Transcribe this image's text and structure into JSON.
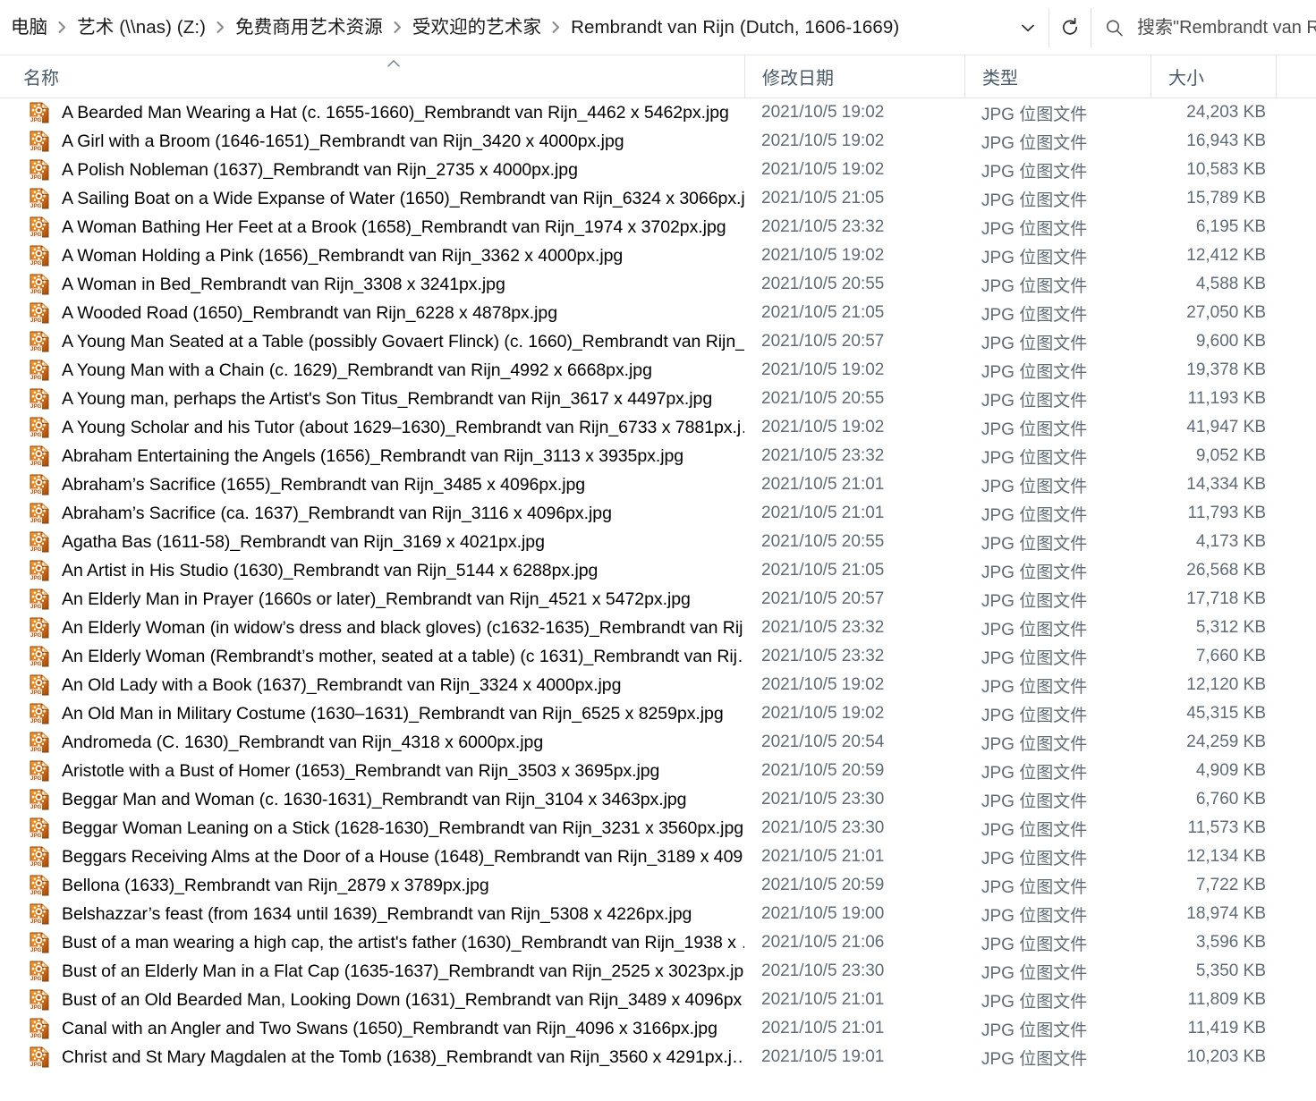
{
  "window": {
    "type": "file-explorer",
    "colors": {
      "header_text": "#4a5a6a",
      "secondary_text": "#5f6b76",
      "icon_orange": "#e08018",
      "icon_brown": "#a24a12",
      "divider": "#e3e3e3"
    }
  },
  "addressbar": {
    "breadcrumbs": [
      "电脑",
      "艺术 (\\\\nas) (Z:)",
      "免费商用艺术资源",
      "受欢迎的艺术家",
      "Rembrandt van Rijn (Dutch, 1606-1669)"
    ],
    "dropdown_icon": "chevron-down-icon",
    "refresh_icon": "refresh-icon",
    "search": {
      "icon": "search-icon",
      "placeholder": "搜索\"Rembrandt van Rij"
    }
  },
  "columns": {
    "name": "名称",
    "date_modified": "修改日期",
    "type": "类型",
    "size": "大小",
    "sort_indicator": "^"
  },
  "files": [
    {
      "name": "A Bearded Man Wearing a Hat (c. 1655-1660)_Rembrandt van Rijn_4462 x 5462px.jpg",
      "date": "2021/10/5 19:02",
      "type": "JPG 位图文件",
      "size": "24,203 KB"
    },
    {
      "name": "A Girl with a Broom (1646-1651)_Rembrandt van Rijn_3420 x 4000px.jpg",
      "date": "2021/10/5 19:02",
      "type": "JPG 位图文件",
      "size": "16,943 KB"
    },
    {
      "name": "A Polish Nobleman (1637)_Rembrandt van Rijn_2735 x 4000px.jpg",
      "date": "2021/10/5 19:02",
      "type": "JPG 位图文件",
      "size": "10,583 KB"
    },
    {
      "name": "A Sailing Boat on a Wide Expanse of Water (1650)_Rembrandt van Rijn_6324 x 3066px.j…",
      "date": "2021/10/5 21:05",
      "type": "JPG 位图文件",
      "size": "15,789 KB"
    },
    {
      "name": "A Woman Bathing Her Feet at a Brook (1658)_Rembrandt van Rijn_1974 x 3702px.jpg",
      "date": "2021/10/5 23:32",
      "type": "JPG 位图文件",
      "size": "6,195 KB"
    },
    {
      "name": "A Woman Holding a Pink (1656)_Rembrandt van Rijn_3362 x 4000px.jpg",
      "date": "2021/10/5 19:02",
      "type": "JPG 位图文件",
      "size": "12,412 KB"
    },
    {
      "name": "A Woman in Bed_Rembrandt van Rijn_3308 x 3241px.jpg",
      "date": "2021/10/5 20:55",
      "type": "JPG 位图文件",
      "size": "4,588 KB"
    },
    {
      "name": "A Wooded Road (1650)_Rembrandt van Rijn_6228 x 4878px.jpg",
      "date": "2021/10/5 21:05",
      "type": "JPG 位图文件",
      "size": "27,050 KB"
    },
    {
      "name": "A Young Man Seated at a Table (possibly Govaert Flinck) (c. 1660)_Rembrandt van Rijn_…",
      "date": "2021/10/5 20:57",
      "type": "JPG 位图文件",
      "size": "9,600 KB"
    },
    {
      "name": "A Young Man with a Chain (c. 1629)_Rembrandt van Rijn_4992 x 6668px.jpg",
      "date": "2021/10/5 19:02",
      "type": "JPG 位图文件",
      "size": "19,378 KB"
    },
    {
      "name": "A Young man, perhaps the Artist's Son Titus_Rembrandt van Rijn_3617 x 4497px.jpg",
      "date": "2021/10/5 20:55",
      "type": "JPG 位图文件",
      "size": "11,193 KB"
    },
    {
      "name": "A Young Scholar and his Tutor (about 1629–1630)_Rembrandt van Rijn_6733 x 7881px.j…",
      "date": "2021/10/5 19:02",
      "type": "JPG 位图文件",
      "size": "41,947 KB"
    },
    {
      "name": "Abraham Entertaining the Angels (1656)_Rembrandt van Rijn_3113 x 3935px.jpg",
      "date": "2021/10/5 23:32",
      "type": "JPG 位图文件",
      "size": "9,052 KB"
    },
    {
      "name": "Abraham’s Sacrifice (1655)_Rembrandt van Rijn_3485 x 4096px.jpg",
      "date": "2021/10/5 21:01",
      "type": "JPG 位图文件",
      "size": "14,334 KB"
    },
    {
      "name": "Abraham’s Sacrifice (ca. 1637)_Rembrandt van Rijn_3116 x 4096px.jpg",
      "date": "2021/10/5 21:01",
      "type": "JPG 位图文件",
      "size": "11,793 KB"
    },
    {
      "name": "Agatha Bas (1611-58)_Rembrandt van Rijn_3169 x 4021px.jpg",
      "date": "2021/10/5 20:55",
      "type": "JPG 位图文件",
      "size": "4,173 KB"
    },
    {
      "name": "An Artist in His Studio (1630)_Rembrandt van Rijn_5144 x 6288px.jpg",
      "date": "2021/10/5 21:05",
      "type": "JPG 位图文件",
      "size": "26,568 KB"
    },
    {
      "name": "An Elderly Man in Prayer (1660s or later)_Rembrandt van Rijn_4521 x 5472px.jpg",
      "date": "2021/10/5 20:57",
      "type": "JPG 位图文件",
      "size": "17,718 KB"
    },
    {
      "name": "An Elderly Woman (in widow’s dress and black gloves) (c1632-1635)_Rembrandt van Rij…",
      "date": "2021/10/5 23:32",
      "type": "JPG 位图文件",
      "size": "5,312 KB"
    },
    {
      "name": "An Elderly Woman (Rembrandt’s mother, seated at a table) (c 1631)_Rembrandt van Rij…",
      "date": "2021/10/5 23:32",
      "type": "JPG 位图文件",
      "size": "7,660 KB"
    },
    {
      "name": "An Old Lady with a Book (1637)_Rembrandt van Rijn_3324 x 4000px.jpg",
      "date": "2021/10/5 19:02",
      "type": "JPG 位图文件",
      "size": "12,120 KB"
    },
    {
      "name": "An Old Man in Military Costume (1630–1631)_Rembrandt van Rijn_6525 x 8259px.jpg",
      "date": "2021/10/5 19:02",
      "type": "JPG 位图文件",
      "size": "45,315 KB"
    },
    {
      "name": "Andromeda (C. 1630)_Rembrandt van Rijn_4318 x 6000px.jpg",
      "date": "2021/10/5 20:54",
      "type": "JPG 位图文件",
      "size": "24,259 KB"
    },
    {
      "name": "Aristotle with a Bust of Homer (1653)_Rembrandt van Rijn_3503 x 3695px.jpg",
      "date": "2021/10/5 20:59",
      "type": "JPG 位图文件",
      "size": "4,909 KB"
    },
    {
      "name": "Beggar Man and Woman (c. 1630-1631)_Rembrandt van Rijn_3104 x 3463px.jpg",
      "date": "2021/10/5 23:30",
      "type": "JPG 位图文件",
      "size": "6,760 KB"
    },
    {
      "name": "Beggar Woman Leaning on a Stick (1628-1630)_Rembrandt van Rijn_3231 x 3560px.jpg",
      "date": "2021/10/5 23:30",
      "type": "JPG 位图文件",
      "size": "11,573 KB"
    },
    {
      "name": "Beggars Receiving Alms at the Door of a House (1648)_Rembrandt van Rijn_3189 x 409…",
      "date": "2021/10/5 21:01",
      "type": "JPG 位图文件",
      "size": "12,134 KB"
    },
    {
      "name": "Bellona (1633)_Rembrandt van Rijn_2879 x 3789px.jpg",
      "date": "2021/10/5 20:59",
      "type": "JPG 位图文件",
      "size": "7,722 KB"
    },
    {
      "name": "Belshazzar’s feast (from 1634 until 1639)_Rembrandt van Rijn_5308 x 4226px.jpg",
      "date": "2021/10/5 19:00",
      "type": "JPG 位图文件",
      "size": "18,974 KB"
    },
    {
      "name": "Bust of a man wearing a high cap, the artist's father (1630)_Rembrandt van Rijn_1938 x …",
      "date": "2021/10/5 21:06",
      "type": "JPG 位图文件",
      "size": "3,596 KB"
    },
    {
      "name": "Bust of an Elderly Man in a Flat Cap (1635-1637)_Rembrandt van Rijn_2525 x 3023px.jpg",
      "date": "2021/10/5 23:30",
      "type": "JPG 位图文件",
      "size": "5,350 KB"
    },
    {
      "name": "Bust of an Old Bearded Man, Looking Down (1631)_Rembrandt van Rijn_3489 x 4096px…",
      "date": "2021/10/5 21:01",
      "type": "JPG 位图文件",
      "size": "11,809 KB"
    },
    {
      "name": "Canal with an Angler and Two Swans (1650)_Rembrandt van Rijn_4096 x 3166px.jpg",
      "date": "2021/10/5 21:01",
      "type": "JPG 位图文件",
      "size": "11,419 KB"
    },
    {
      "name": "Christ and St Mary Magdalen at the Tomb (1638)_Rembrandt van Rijn_3560 x 4291px.j…",
      "date": "2021/10/5 19:01",
      "type": "JPG 位图文件",
      "size": "10,203 KB"
    }
  ]
}
